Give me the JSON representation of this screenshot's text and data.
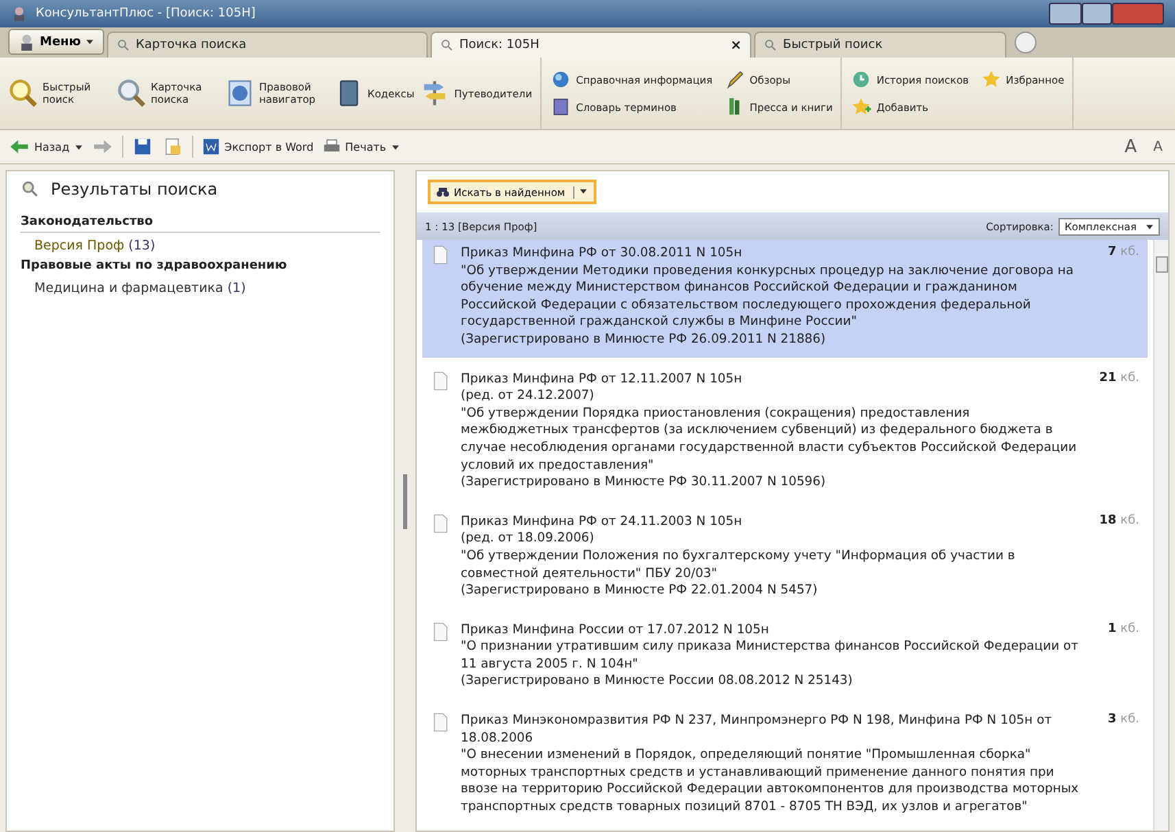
{
  "window": {
    "title": "КонсультантПлюс - [Поиск: 105Н]"
  },
  "menu_button": "Меню",
  "tabs": [
    {
      "label": "Карточка поиска",
      "selected": false
    },
    {
      "label": "Поиск: 105Н",
      "selected": true
    },
    {
      "label": "Быстрый поиск",
      "selected": false
    }
  ],
  "close_tab": "×",
  "ribbon": [
    {
      "items": [
        {
          "label": "Быстрый поиск"
        },
        {
          "label": "Карточка поиска"
        },
        {
          "label": "Правовой навигатор"
        },
        {
          "label": "Кодексы"
        },
        {
          "label": "Путеводители"
        }
      ]
    },
    {
      "items": [
        {
          "label": "Справочная информация"
        },
        {
          "label": "Обзоры"
        },
        {
          "label": "Словарь терминов"
        },
        {
          "label": "Пресса и книги"
        }
      ]
    },
    {
      "items": [
        {
          "label": "История поисков"
        },
        {
          "label": "Избранное"
        },
        {
          "label": "Добавить"
        }
      ]
    }
  ],
  "nav_toolbar": {
    "back": "Назад",
    "export": "Экспорт в Word",
    "print": "Печать",
    "font_buttons": [
      "A",
      "A"
    ]
  },
  "results_panel": {
    "title": "Результаты поиска",
    "sections": [
      {
        "title": "Законодательство",
        "items": [
          {
            "label": "Версия Проф",
            "count": "(13)",
            "selected": true
          }
        ]
      },
      {
        "title": "Правовые акты по здравоохранению",
        "items": [
          {
            "label": "Медицина и фармацевтика",
            "count": "(1)",
            "selected": false
          }
        ]
      }
    ]
  },
  "search_in_found": "Искать в найденном",
  "list_header": {
    "summary": "1 : 13 [Версия Проф]",
    "sort_label": "Сортировка:",
    "sort_value": "Комплексная"
  },
  "documents": [
    {
      "title": "Приказ Минфина РФ от 30.08.2011 N 105н",
      "description": "\"Об утверждении Методики проведения конкурсных процедур на заключение договора на обучение между Министерством финансов Российской Федерации и гражданином Российской Федерации с обязательством последующего прохождения федеральной государственной гражданской службы в Минфине России\"",
      "registration": "(Зарегистрировано в Минюсте РФ 26.09.2011 N 21886)",
      "size": "7",
      "unit": "кб.",
      "selected": true
    },
    {
      "title": "Приказ Минфина РФ от 12.11.2007 N 105н",
      "edition": "(ред. от 24.12.2007)",
      "description": "\"Об утверждении Порядка приостановления (сокращения) предоставления межбюджетных трансфертов (за исключением субвенций) из федерального бюджета в случае несоблюдения органами государственной власти субъектов Российской Федерации условий их предоставления\"",
      "registration": "(Зарегистрировано в Минюсте РФ 30.11.2007 N 10596)",
      "size": "21",
      "unit": "кб.",
      "selected": false
    },
    {
      "title": "Приказ Минфина РФ от 24.11.2003 N 105н",
      "edition": "(ред. от 18.09.2006)",
      "description": "\"Об утверждении Положения по бухгалтерскому учету \"Информация об участии в совместной деятельности\" ПБУ 20/03\"",
      "registration": "(Зарегистрировано в Минюсте РФ 22.01.2004 N 5457)",
      "size": "18",
      "unit": "кб.",
      "selected": false
    },
    {
      "title": "Приказ Минфина России от 17.07.2012 N 105н",
      "description": "\"О признании утратившим силу приказа Министерства финансов Российской Федерации от 11 августа 2005 г. N 104н\"",
      "registration": "(Зарегистрировано в Минюсте России 08.08.2012 N 25143)",
      "size": "1",
      "unit": "кб.",
      "selected": false
    },
    {
      "title": "Приказ Минэкономразвития РФ N 237, Минпромэнерго РФ N 198, Минфина РФ N 105н от 18.08.2006",
      "description": "\"О внесении изменений в Порядок, определяющий понятие \"Промышленная сборка\" моторных транспортных средств и устанавливающий применение данного понятия при ввозе на территорию Российской Федерации автокомпонентов для производства моторных транспортных средств товарных позиций 8701 - 8705 ТН ВЭД, их узлов и агрегатов\"",
      "size": "3",
      "unit": "кб.",
      "selected": false
    }
  ]
}
